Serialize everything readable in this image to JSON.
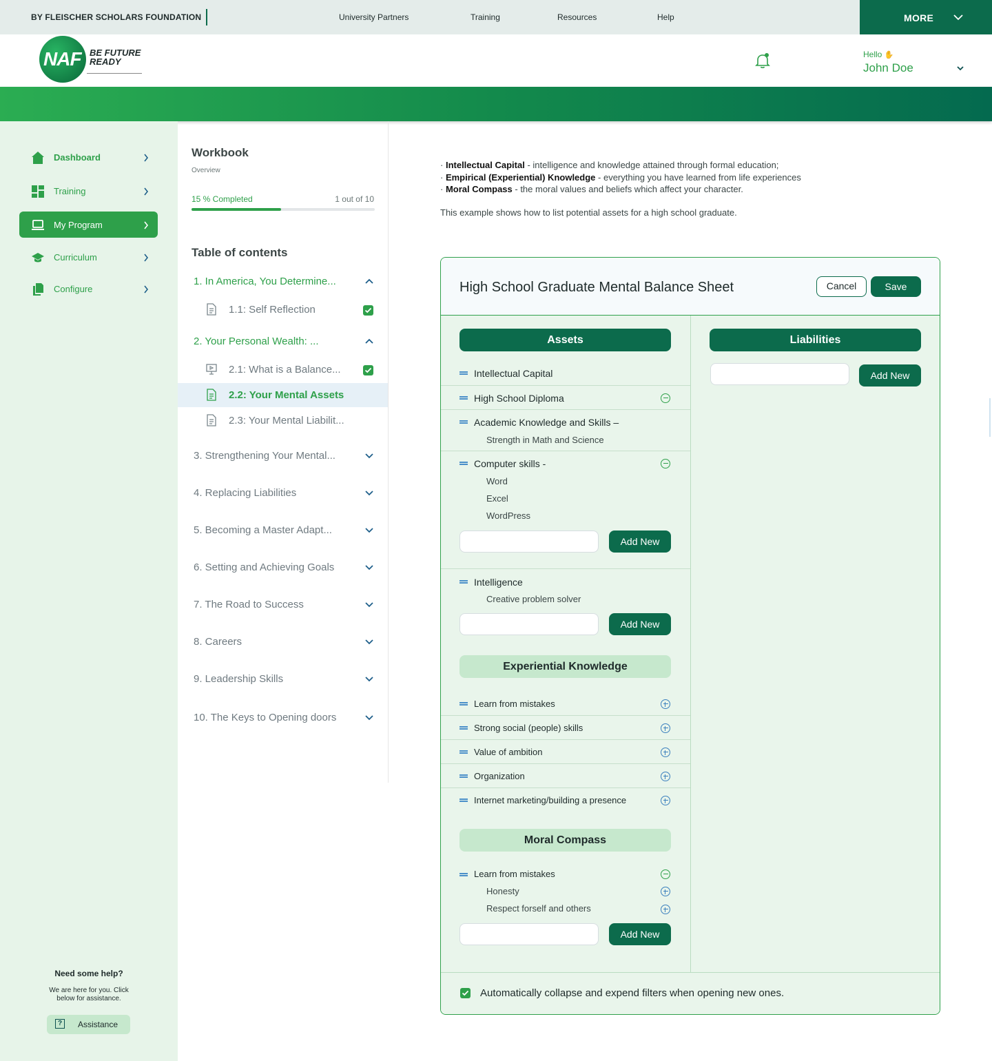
{
  "topbar": {
    "brand": "BY FLEISCHER SCHOLARS FOUNDATION",
    "nav": [
      "University Partners",
      "Training",
      "Resources",
      "Help"
    ],
    "more_label": "MORE"
  },
  "header": {
    "logo_text": "NAF",
    "logo_tagline_1": "BE FUTURE",
    "logo_tagline_2": "READY",
    "greeting": "Hello",
    "user_name": "John Doe"
  },
  "sidebar": {
    "items": [
      {
        "label": "Dashboard",
        "icon": "home-icon"
      },
      {
        "label": "Training",
        "icon": "grid-icon"
      },
      {
        "label": "My Program",
        "icon": "monitor-icon"
      },
      {
        "label": "Curriculum",
        "icon": "graduation-cap-icon"
      },
      {
        "label": "Configure",
        "icon": "documents-icon"
      }
    ],
    "help_title": "Need some help?",
    "help_text": "We are here for you. Click below for assistance.",
    "assist_label": "Assistance"
  },
  "workbook": {
    "title": "Workbook",
    "subtitle": "Overview",
    "progress_label": "15 % Completed",
    "progress_count": "1 out of 10",
    "progress_fraction": 0.49,
    "toc_title": "Table of contents",
    "chapters": [
      {
        "label": "1.  In America, You Determine..."
      },
      {
        "label": "2.  Your Personal Wealth: ..."
      },
      {
        "label": "3. Strengthening Your Mental..."
      },
      {
        "label": "4. Replacing Liabilities"
      },
      {
        "label": "5. Becoming a Master Adapt..."
      },
      {
        "label": "6. Setting and Achieving Goals"
      },
      {
        "label": "7. The Road to Success"
      },
      {
        "label": "8. Careers"
      },
      {
        "label": "9. Leadership Skills"
      },
      {
        "label": "10. The Keys to Opening doors"
      }
    ],
    "lessons": [
      {
        "label": "1.1: Self Reflection"
      },
      {
        "label": "2.1: What is a Balance..."
      },
      {
        "label": "2.2: Your Mental Assets"
      },
      {
        "label": "2.3: Your Mental Liabilit..."
      }
    ]
  },
  "intro": {
    "items": [
      {
        "term": "Intellectual Capital",
        "desc": " - intelligence and knowledge attained through formal education;"
      },
      {
        "term": "Empirical (Experiential) Knowledge",
        "desc": " - everything you have learned from life experiences"
      },
      {
        "term": "Moral Compass",
        "desc": " - the moral values and beliefs which affect your character."
      }
    ],
    "note": "This example shows how to list potential assets for a high school graduate."
  },
  "sheet": {
    "title": "High School Graduate Mental Balance Sheet",
    "cancel_label": "Cancel",
    "save_label": "Save",
    "assets_label": "Assets",
    "liabilities_label": "Liabilities",
    "add_new_label": "Add New",
    "intellectual": {
      "title": "Intellectual Capital",
      "rows": [
        {
          "label": "High School Diploma"
        },
        {
          "label": "Academic Knowledge and Skills –",
          "sub": [
            "Strength in Math and Science"
          ]
        },
        {
          "label": "Computer skills -",
          "sub": [
            "Word",
            "Excel",
            "WordPress"
          ]
        },
        {
          "label": "Intelligence",
          "sub": [
            "Creative problem solver"
          ]
        }
      ]
    },
    "experiential": {
      "title": "Experiential Knowledge",
      "rows": [
        "Learn from mistakes",
        "Strong social (people) skills",
        "Value of ambition",
        "Organization",
        "Internet marketing/building a presence"
      ]
    },
    "moral": {
      "title": "Moral Compass",
      "rows": [
        {
          "label": "Learn from mistakes",
          "sub": [
            "Honesty",
            "Respect forself and others"
          ]
        }
      ]
    },
    "footer_label": "Automatically collapse and expend filters when opening new ones."
  }
}
